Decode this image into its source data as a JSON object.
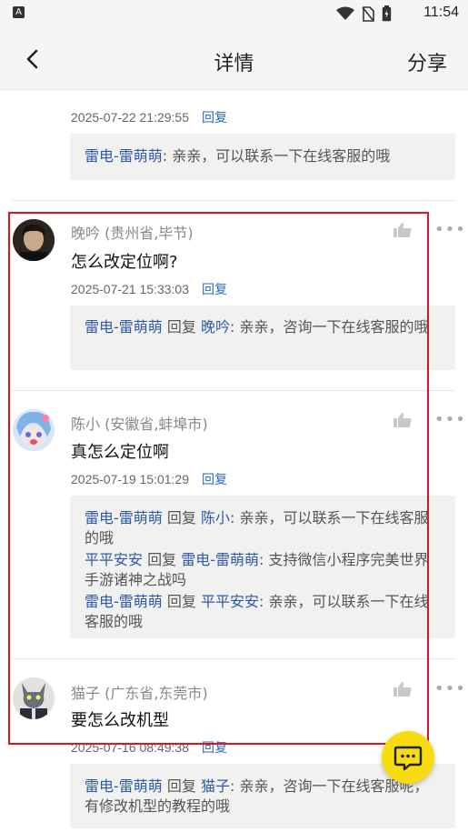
{
  "status_bar": {
    "time": "11:54",
    "app_icon": "A"
  },
  "header": {
    "title": "详情",
    "share_label": "分享",
    "back_icon": "chevron-left-icon"
  },
  "top_fragment": {
    "timestamp": "2025-07-22 21:29:55",
    "reply_label": "回复",
    "reply": {
      "from": "雷电-雷萌萌",
      "text": ": 亲亲，可以联系一下在线客服的哦"
    }
  },
  "comments": [
    {
      "author": "晚吟 (贵州省,毕节)",
      "text": "怎么改定位啊?",
      "timestamp": "2025-07-21 15:33:03",
      "reply_label": "回复",
      "replies": [
        {
          "from": "雷电-雷萌萌",
          "verb": " 回复 ",
          "to": "晚吟",
          "text": ": 亲亲，咨询一下在线客服的哦"
        }
      ]
    },
    {
      "author": "陈小 (安徽省,蚌埠市)",
      "text": "真怎么定位啊",
      "timestamp": "2025-07-19 15:01:29",
      "reply_label": "回复",
      "replies": [
        {
          "from": "雷电-雷萌萌",
          "verb": " 回复 ",
          "to": "陈小",
          "text": ": 亲亲，可以联系一下在线客服的哦"
        },
        {
          "from": "平平安安",
          "verb": " 回复 ",
          "to": "雷电-雷萌萌",
          "text": ": 支持微信小程序完美世界手游诸神之战吗"
        },
        {
          "from": "雷电-雷萌萌",
          "verb": " 回复 ",
          "to": "平平安安",
          "text": ": 亲亲，可以联系一下在线客服的哦"
        }
      ]
    },
    {
      "author": "猫子 (广东省,东莞市)",
      "text": "要怎么改机型",
      "timestamp": "2025-07-16 08:49:38",
      "reply_label": "回复",
      "replies": [
        {
          "from": "雷电-雷萌萌",
          "verb": " 回复 ",
          "to": "猫子",
          "text": ": 亲亲，咨询一下在线客服呢，有修改机型的教程的哦"
        }
      ]
    }
  ],
  "colors": {
    "accent_yellow": "#f8db10",
    "name_blue": "#2f5aa8",
    "highlight_red": "#e0141e"
  }
}
